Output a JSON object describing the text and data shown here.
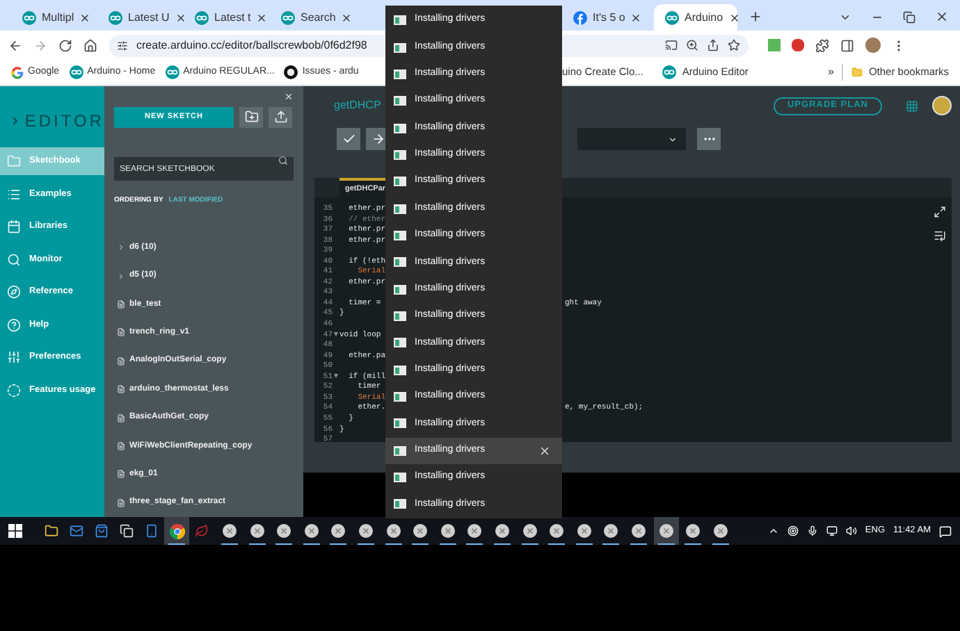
{
  "browser_tabs": [
    {
      "kind": "arduino",
      "title": "Multipl",
      "selected": false
    },
    {
      "kind": "arduino",
      "title": "Latest U",
      "selected": false
    },
    {
      "kind": "arduino",
      "title": "Latest t",
      "selected": false
    },
    {
      "kind": "arduino",
      "title": "Search",
      "selected": false
    },
    {
      "kind": "facebook",
      "title": "It's 5 o",
      "selected": false
    },
    {
      "kind": "arduino",
      "title": "Arduino",
      "selected": true
    }
  ],
  "address": "create.arduino.cc/editor/ballscrewbob/0f6d2f98",
  "bookmarks": [
    {
      "kind": "google",
      "label": "Google"
    },
    {
      "kind": "arduino",
      "label": "Arduino - Home"
    },
    {
      "kind": "arduino",
      "label": "Arduino REGULAR..."
    },
    {
      "kind": "github",
      "label": "Issues - ardu"
    },
    {
      "kind": "none",
      "label": "uino Create Clo..."
    },
    {
      "kind": "arduino",
      "label": "Arduino Editor"
    }
  ],
  "bookmarks_more": "»",
  "other_bookmarks": "Other bookmarks",
  "editor_title": "EDITOR",
  "nav": [
    {
      "kind": "sketchbook",
      "label": "Sketchbook",
      "selected": true
    },
    {
      "kind": "examples",
      "label": "Examples",
      "selected": false
    },
    {
      "kind": "libraries",
      "label": "Libraries",
      "selected": false
    },
    {
      "kind": "monitor",
      "label": "Monitor",
      "selected": false
    },
    {
      "kind": "reference",
      "label": "Reference",
      "selected": false
    },
    {
      "kind": "help",
      "label": "Help",
      "selected": false
    },
    {
      "kind": "preferences",
      "label": "Preferences",
      "selected": false
    },
    {
      "kind": "features",
      "label": "Features usage",
      "selected": false
    }
  ],
  "new_sketch": "NEW SKETCH",
  "search": {
    "placeholder": "SEARCH SKETCHBOOK"
  },
  "ordering": {
    "label": "ORDERING BY",
    "value": "LAST MODIFIED"
  },
  "sketches": [
    {
      "kind": "folder",
      "name": "d6 (10)"
    },
    {
      "kind": "folder",
      "name": "d5 (10)"
    },
    {
      "kind": "sketch",
      "name": "ble_test"
    },
    {
      "kind": "sketch",
      "name": "trench_ring_v1"
    },
    {
      "kind": "sketch",
      "name": "AnalogInOutSerial_copy"
    },
    {
      "kind": "sketch",
      "name": "arduino_thermostat_less"
    },
    {
      "kind": "sketch",
      "name": "BasicAuthGet_copy"
    },
    {
      "kind": "sketch",
      "name": "WiFiWebClientRepeating_copy"
    },
    {
      "kind": "sketch",
      "name": "ekg_01"
    },
    {
      "kind": "sketch",
      "name": "three_stage_fan_extract"
    }
  ],
  "sketch_title": "getDHCP",
  "upgrade": "UPGRADE PLAN",
  "code_tab": "getDHCPar",
  "code": [
    {
      "number": "35",
      "kind": "code",
      "fold": false,
      "text": "  ether.pr"
    },
    {
      "number": "36",
      "kind": "comment",
      "fold": false,
      "text": "  // ether"
    },
    {
      "number": "37",
      "kind": "code",
      "fold": false,
      "text": "  ether.pr"
    },
    {
      "number": "38",
      "kind": "code",
      "fold": false,
      "text": "  ether.pr"
    },
    {
      "number": "39",
      "fold": false
    },
    {
      "number": "40",
      "kind": "code",
      "fold": false,
      "text": "  if (!eth"
    },
    {
      "number": "41",
      "kind": "serial",
      "fold": false,
      "text": "    Serial"
    },
    {
      "number": "42",
      "kind": "code",
      "fold": false,
      "text": "  ether.pr"
    },
    {
      "number": "43",
      "fold": false
    },
    {
      "number": "44",
      "kind": "code",
      "fold": false,
      "text": "  timer =",
      "right": "ght away"
    },
    {
      "number": "45",
      "kind": "code",
      "fold": false,
      "text": "}"
    },
    {
      "number": "46",
      "fold": false
    },
    {
      "number": "47",
      "kind": "code",
      "fold": true,
      "text": "void loop"
    },
    {
      "number": "48",
      "fold": false
    },
    {
      "number": "49",
      "kind": "code",
      "fold": false,
      "text": "  ether.pa"
    },
    {
      "number": "50",
      "fold": false
    },
    {
      "number": "51",
      "kind": "code",
      "fold": true,
      "text": "  if (mill"
    },
    {
      "number": "52",
      "kind": "code",
      "fold": false,
      "text": "    timer"
    },
    {
      "number": "53",
      "kind": "serial",
      "fold": false,
      "text": "    Serial"
    },
    {
      "number": "54",
      "kind": "code",
      "fold": false,
      "text": "    ether.",
      "right": "e, my_result_cb);"
    },
    {
      "number": "55",
      "kind": "code",
      "fold": false,
      "text": "  }"
    },
    {
      "number": "56",
      "kind": "code",
      "fold": false,
      "text": "}"
    },
    {
      "number": "57",
      "fold": false
    }
  ],
  "notifications": [
    {
      "title": "Installing drivers",
      "selected": false
    },
    {
      "title": "Installing drivers",
      "selected": false
    },
    {
      "title": "Installing drivers",
      "selected": false
    },
    {
      "title": "Installing drivers",
      "selected": false
    },
    {
      "title": "Installing drivers",
      "selected": false
    },
    {
      "title": "Installing drivers",
      "selected": false
    },
    {
      "title": "Installing drivers",
      "selected": false
    },
    {
      "title": "Installing drivers",
      "selected": false
    },
    {
      "title": "Installing drivers",
      "selected": false
    },
    {
      "title": "Installing drivers",
      "selected": false
    },
    {
      "title": "Installing drivers",
      "selected": false
    },
    {
      "title": "Installing drivers",
      "selected": false
    },
    {
      "title": "Installing drivers",
      "selected": false
    },
    {
      "title": "Installing drivers",
      "selected": false
    },
    {
      "title": "Installing drivers",
      "selected": false
    },
    {
      "title": "Installing drivers",
      "selected": false
    },
    {
      "title": "Installing drivers",
      "selected": true
    },
    {
      "title": "Installing drivers",
      "selected": false
    },
    {
      "title": "Installing drivers",
      "selected": false
    }
  ],
  "taskbar": {
    "apps": [
      {
        "kind": "explorer",
        "running": false,
        "selected": false
      },
      {
        "kind": "mail",
        "running": false,
        "selected": false
      },
      {
        "kind": "store",
        "running": false,
        "selected": false
      },
      {
        "kind": "cards",
        "running": false,
        "selected": false
      },
      {
        "kind": "phone",
        "running": false,
        "selected": false
      },
      {
        "kind": "chrome",
        "running": true,
        "selected": true
      },
      {
        "kind": "leaf",
        "running": false,
        "selected": false
      },
      {
        "kind": "generic",
        "running": true,
        "selected": false
      },
      {
        "kind": "generic",
        "running": true,
        "selected": false
      },
      {
        "kind": "generic",
        "running": true,
        "selected": false
      },
      {
        "kind": "generic",
        "running": true,
        "selected": false
      },
      {
        "kind": "generic",
        "running": true,
        "selected": false
      },
      {
        "kind": "generic",
        "running": true,
        "selected": false
      },
      {
        "kind": "generic",
        "running": true,
        "selected": false
      },
      {
        "kind": "generic",
        "running": true,
        "selected": false
      },
      {
        "kind": "generic",
        "running": true,
        "selected": false
      },
      {
        "kind": "generic",
        "running": true,
        "selected": false
      },
      {
        "kind": "generic",
        "running": true,
        "selected": false
      },
      {
        "kind": "generic",
        "running": true,
        "selected": false
      },
      {
        "kind": "generic",
        "running": true,
        "selected": false
      },
      {
        "kind": "generic",
        "running": true,
        "selected": false
      },
      {
        "kind": "generic",
        "running": true,
        "selected": false
      },
      {
        "kind": "generic",
        "running": true,
        "selected": false
      },
      {
        "kind": "generic",
        "running": true,
        "selected": true
      },
      {
        "kind": "generic",
        "running": true,
        "selected": false
      },
      {
        "kind": "generic",
        "running": true,
        "selected": false
      }
    ],
    "language": "ENG",
    "time": "11:42 AM"
  }
}
